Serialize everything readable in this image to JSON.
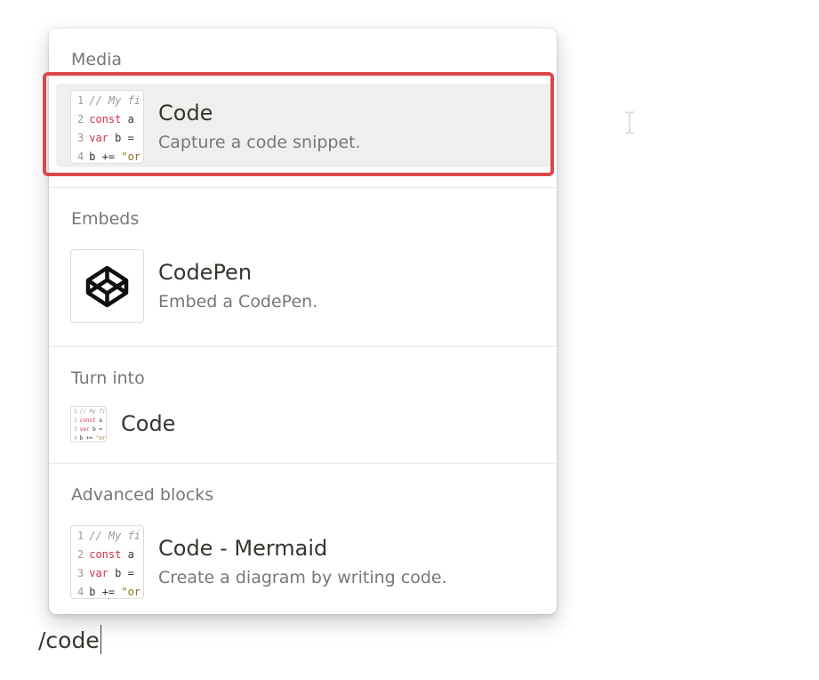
{
  "menu": {
    "sections": [
      {
        "label": "Media",
        "items": [
          {
            "title": "Code",
            "description": "Capture a code snippet.",
            "icon": "code-block-icon"
          }
        ]
      },
      {
        "label": "Embeds",
        "items": [
          {
            "title": "CodePen",
            "description": "Embed a CodePen.",
            "icon": "codepen-icon"
          }
        ]
      },
      {
        "label": "Turn into",
        "items": [
          {
            "title": "Code",
            "icon": "code-block-icon"
          }
        ]
      },
      {
        "label": "Advanced blocks",
        "items": [
          {
            "title": "Code - Mermaid",
            "description": "Create a diagram by writing code.",
            "icon": "code-block-icon"
          }
        ]
      }
    ],
    "code_preview": {
      "line1_num": "1",
      "line1_text": "// My fi",
      "line2_num": "2",
      "line2_kw": "const",
      "line2_text": " a",
      "line3_num": "3",
      "line3_kw": "var",
      "line3_text": " b =",
      "line4_num": "4",
      "line4_text": "b += ",
      "line4_str": "\"or"
    },
    "highlight_color": "#dc4747"
  },
  "editor": {
    "text": "/code"
  }
}
